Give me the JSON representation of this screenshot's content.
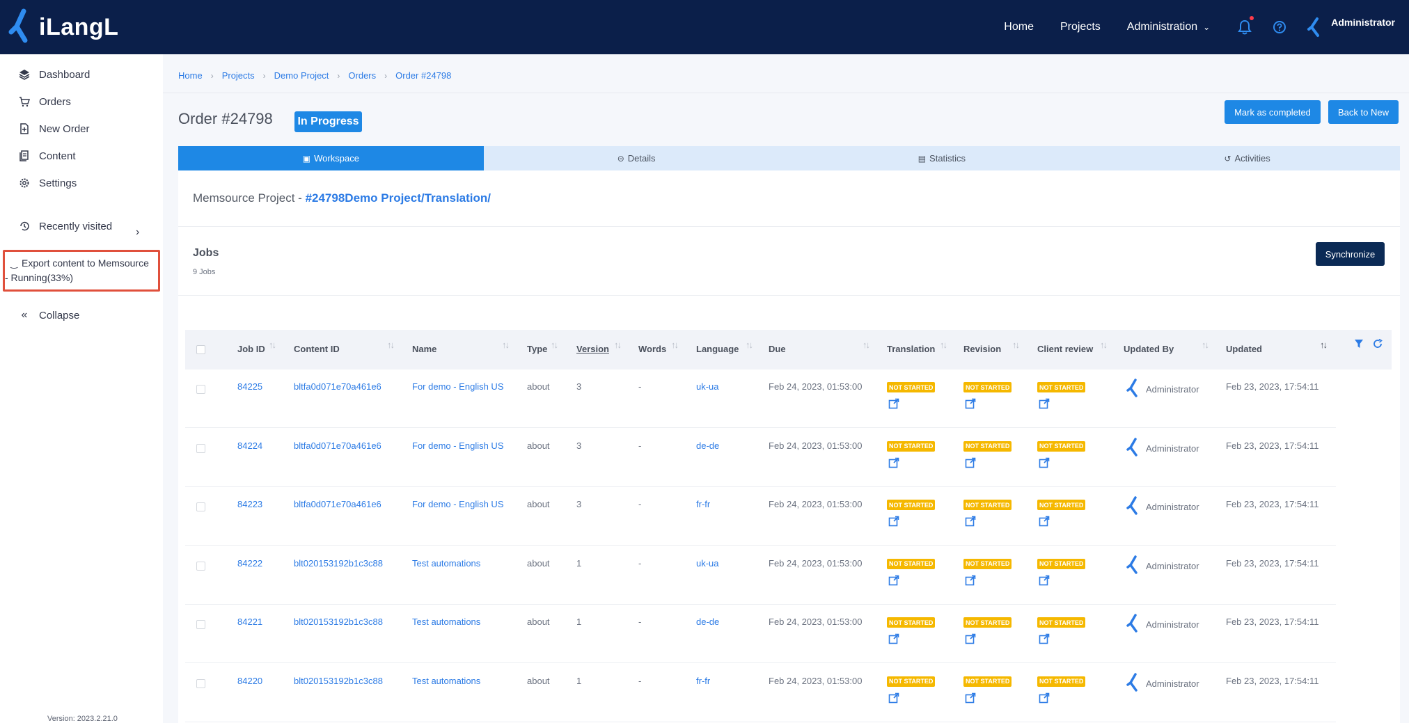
{
  "app": {
    "logo_text": "iLangL",
    "topnav": {
      "home": "Home",
      "projects": "Projects",
      "administration": "Administration",
      "user_name": "Administrator"
    }
  },
  "sidebar": {
    "items": [
      {
        "label": "Dashboard",
        "icon": "layers-icon"
      },
      {
        "label": "Orders",
        "icon": "cart-icon"
      },
      {
        "label": "New Order",
        "icon": "new-doc-icon"
      },
      {
        "label": "Content",
        "icon": "documents-icon"
      },
      {
        "label": "Settings",
        "icon": "gear-icon"
      }
    ],
    "recently_visited": "Recently visited",
    "export_status_line1": "Export content to Memsource",
    "export_status_line2": "- Running(33%)",
    "collapse": "Collapse",
    "version": "Version: 2023.2.21.0"
  },
  "breadcrumb": [
    "Home",
    "Projects",
    "Demo Project",
    "Orders",
    "Order #24798"
  ],
  "order": {
    "title": "Order #24798",
    "status": "In Progress",
    "mark_completed": "Mark as completed",
    "back_to_new": "Back to New"
  },
  "tabs": [
    {
      "label": "Workspace",
      "icon": "workspace-icon",
      "active": true
    },
    {
      "label": "Details",
      "icon": "info-icon",
      "active": false
    },
    {
      "label": "Statistics",
      "icon": "stats-icon",
      "active": false
    },
    {
      "label": "Activities",
      "icon": "history-icon",
      "active": false
    }
  ],
  "memsource": {
    "label": "Memsource Project -",
    "link": "#24798Demo Project/Translation/"
  },
  "jobs": {
    "title": "Jobs",
    "count": "9 Jobs",
    "synchronize": "Synchronize",
    "columns": [
      "Job ID",
      "Content ID",
      "Name",
      "Type",
      "Version",
      "Words",
      "Language",
      "Due",
      "Translation",
      "Revision",
      "Client review",
      "Updated By",
      "Updated"
    ],
    "status_label": "NOT STARTED",
    "rows": [
      {
        "job_id": "84225",
        "content_id": "bltfa0d071e70a461e6",
        "name": "For demo - English US",
        "type": "about",
        "version": "3",
        "words": "-",
        "language": "uk-ua",
        "due": "Feb 24, 2023, 01:53:00",
        "updated_by": "Administrator",
        "updated": "Feb 23, 2023, 17:54:11"
      },
      {
        "job_id": "84224",
        "content_id": "bltfa0d071e70a461e6",
        "name": "For demo - English US",
        "type": "about",
        "version": "3",
        "words": "-",
        "language": "de-de",
        "due": "Feb 24, 2023, 01:53:00",
        "updated_by": "Administrator",
        "updated": "Feb 23, 2023, 17:54:11"
      },
      {
        "job_id": "84223",
        "content_id": "bltfa0d071e70a461e6",
        "name": "For demo - English US",
        "type": "about",
        "version": "3",
        "words": "-",
        "language": "fr-fr",
        "due": "Feb 24, 2023, 01:53:00",
        "updated_by": "Administrator",
        "updated": "Feb 23, 2023, 17:54:11"
      },
      {
        "job_id": "84222",
        "content_id": "blt020153192b1c3c88",
        "name": "Test automations",
        "type": "about",
        "version": "1",
        "words": "-",
        "language": "uk-ua",
        "due": "Feb 24, 2023, 01:53:00",
        "updated_by": "Administrator",
        "updated": "Feb 23, 2023, 17:54:11"
      },
      {
        "job_id": "84221",
        "content_id": "blt020153192b1c3c88",
        "name": "Test automations",
        "type": "about",
        "version": "1",
        "words": "-",
        "language": "de-de",
        "due": "Feb 24, 2023, 01:53:00",
        "updated_by": "Administrator",
        "updated": "Feb 23, 2023, 17:54:11"
      },
      {
        "job_id": "84220",
        "content_id": "blt020153192b1c3c88",
        "name": "Test automations",
        "type": "about",
        "version": "1",
        "words": "-",
        "language": "fr-fr",
        "due": "Feb 24, 2023, 01:53:00",
        "updated_by": "Administrator",
        "updated": "Feb 23, 2023, 17:54:11"
      }
    ]
  },
  "colors": {
    "topbar": "#0b1f4a",
    "accent": "#1e88e5",
    "status_not_started": "#f5b800",
    "highlight_border": "#e0503c"
  }
}
